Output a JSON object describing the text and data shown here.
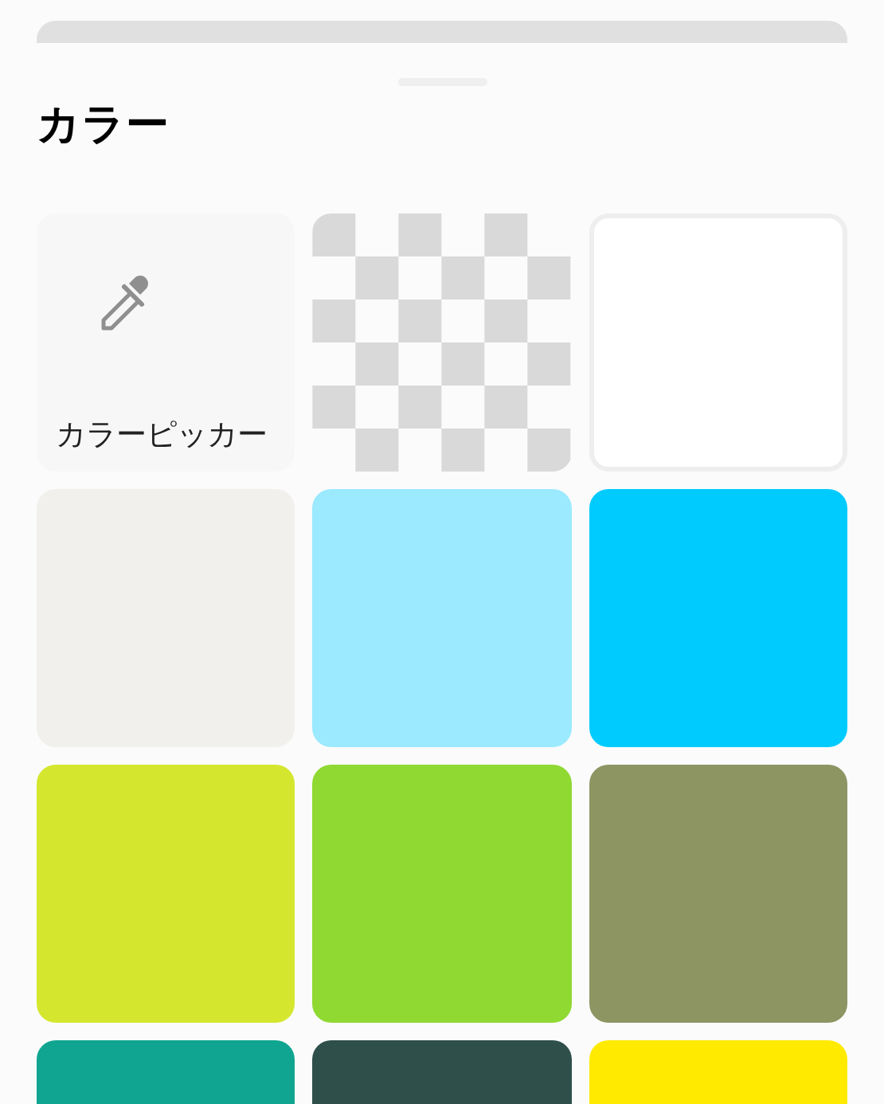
{
  "title": "カラー",
  "swatches": [
    {
      "kind": "picker",
      "label": "カラーピッカー"
    },
    {
      "kind": "transparent"
    },
    {
      "kind": "color",
      "color": "#ffffff"
    },
    {
      "kind": "color",
      "color": "#f1f0ed"
    },
    {
      "kind": "color",
      "color": "#9beaff"
    },
    {
      "kind": "color",
      "color": "#00cbff"
    },
    {
      "kind": "color",
      "color": "#d4e72e"
    },
    {
      "kind": "color",
      "color": "#8fd932"
    },
    {
      "kind": "color",
      "color": "#8d9563"
    },
    {
      "kind": "color",
      "color": "#0fa590"
    },
    {
      "kind": "color",
      "color": "#2f4f4a"
    },
    {
      "kind": "color",
      "color": "#ffea00"
    }
  ]
}
